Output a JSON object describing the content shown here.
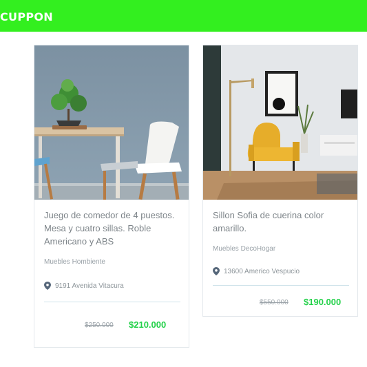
{
  "header": {
    "brand": "CUPPON",
    "color": "#33ef1f"
  },
  "products": [
    {
      "title": "Juego de comedor de 4 puestos. Mesa y cuatro sillas. Roble Americano y ABS",
      "store": "Muebles Hombiente",
      "address": "9191 Avenida Vitacura",
      "old_price": "$250.000",
      "price": "$210.000"
    },
    {
      "title": "Sillon Sofia de cuerina color amarillo.",
      "store": "Muebles DecoHogar",
      "address": "13600 Americo Vespucio",
      "old_price": "$550.000",
      "price": "$190.000"
    }
  ],
  "icons": {
    "location": "location-pin-icon"
  }
}
